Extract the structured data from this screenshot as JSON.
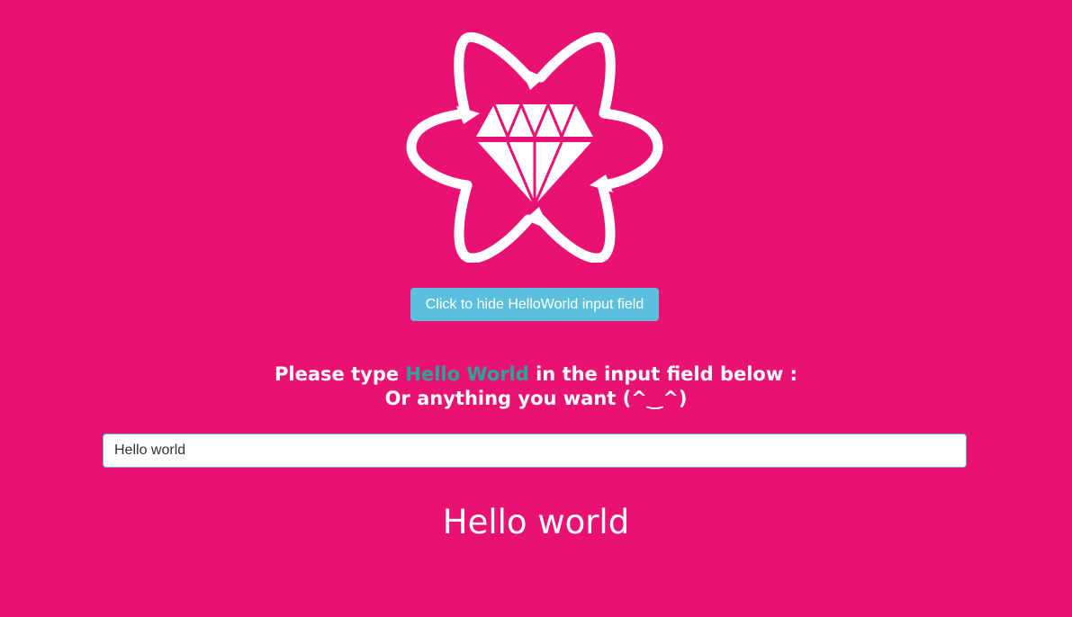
{
  "logo": {
    "icon": "react-gem-atom-logo"
  },
  "toggle_button": {
    "label": "Click to hide HelloWorld input field"
  },
  "prompt": {
    "line1_before": "Please type ",
    "line1_highlight": "Hello World",
    "line1_after": " in the input field below :",
    "line2": "Or anything you want (^‿^)"
  },
  "input": {
    "value": "Hello world"
  },
  "output": {
    "text": "Hello world"
  },
  "colors": {
    "background": "#e91273",
    "button": "#5bc0de",
    "highlight": "#26a69a"
  }
}
